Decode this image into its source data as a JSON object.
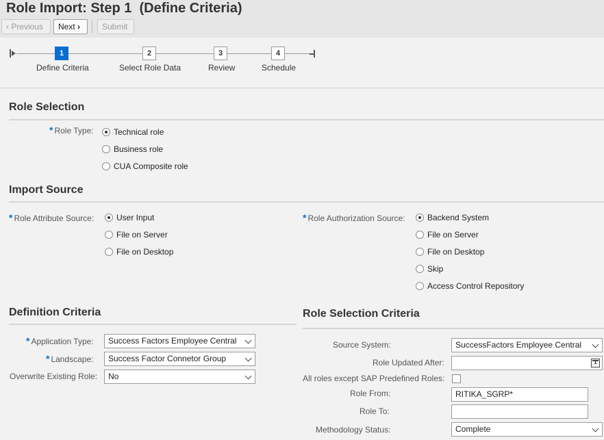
{
  "header": {
    "title": "Role Import: Step 1  (Define Criteria)"
  },
  "toolbar": {
    "previous_label": "Previous",
    "next_label": "Next",
    "submit_label": "Submit"
  },
  "roadmap": {
    "steps": [
      {
        "number": "1",
        "label": "Define Criteria",
        "active": true
      },
      {
        "number": "2",
        "label": "Select Role Data",
        "active": false
      },
      {
        "number": "3",
        "label": "Review",
        "active": false
      },
      {
        "number": "4",
        "label": "Schedule",
        "active": false
      }
    ]
  },
  "role_selection": {
    "title": "Role Selection",
    "role_type_label": "Role Type:",
    "options": [
      "Technical role",
      "Business role",
      "CUA Composite role"
    ],
    "selected": "Technical role"
  },
  "import_source": {
    "title": "Import Source",
    "attribute_label": "Role Attribute Source:",
    "attribute_options": [
      "User Input",
      "File on Server",
      "File on Desktop"
    ],
    "attribute_selected": "User Input",
    "authorization_label": "Role Authorization Source:",
    "authorization_options": [
      "Backend System",
      "File on Server",
      "File on Desktop",
      "Skip",
      "Access Control Repository"
    ],
    "authorization_selected": "Backend System"
  },
  "definition_criteria": {
    "title": "Definition Criteria",
    "application_type_label": "Application Type:",
    "application_type_value": "Success Factors Employee Central",
    "landscape_label": "Landscape:",
    "landscape_value": "Success Factor Connetor Group",
    "overwrite_label": "Overwrite Existing Role:",
    "overwrite_value": "No"
  },
  "role_selection_criteria": {
    "title": "Role Selection Criteria",
    "source_system_label": "Source System:",
    "source_system_value": "SuccessFactors Employee Central",
    "updated_after_label": "Role Updated After:",
    "updated_after_value": "",
    "calendar_day": "1",
    "all_roles_label": "All roles except SAP Predefined Roles:",
    "role_from_label": "Role From:",
    "role_from_value": "RITIKA_SGRP*",
    "role_to_label": "Role To:",
    "role_to_value": "",
    "methodology_label": "Methodology Status:",
    "methodology_value": "Complete"
  },
  "colors": {
    "accent": "#0a6ed1",
    "background": "#f2f2f2",
    "header": "#e6e6e6"
  }
}
